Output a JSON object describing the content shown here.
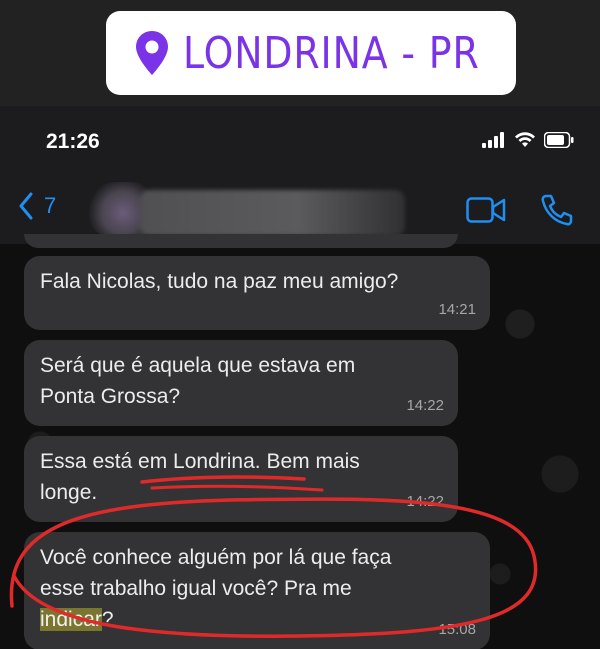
{
  "banner": {
    "location_text": "LONDRINA - PR",
    "pin_icon": "location-pin-icon",
    "accent": "#7a33e6"
  },
  "status_bar": {
    "time": "21:26"
  },
  "nav": {
    "back_count": "7"
  },
  "messages": [
    {
      "text": "Fala Nicolas, tudo na paz meu amigo?",
      "time": "14:21"
    },
    {
      "text": "Será que é aquela que estava em\nPonta Grossa?",
      "time": "14:22"
    },
    {
      "text_before": "Essa está em Londrina.  Bem mais\nlonge.",
      "time": "14:22"
    },
    {
      "text_before": "Você conhece alguém por lá que faça\nesse trabalho igual você? Pra me\n",
      "highlight": "indicar",
      "text_after": "?",
      "time": "15:08"
    }
  ],
  "colors": {
    "bubble": "#333335",
    "link_blue": "#1f8ff2",
    "annotation_red": "#e02a2a"
  }
}
